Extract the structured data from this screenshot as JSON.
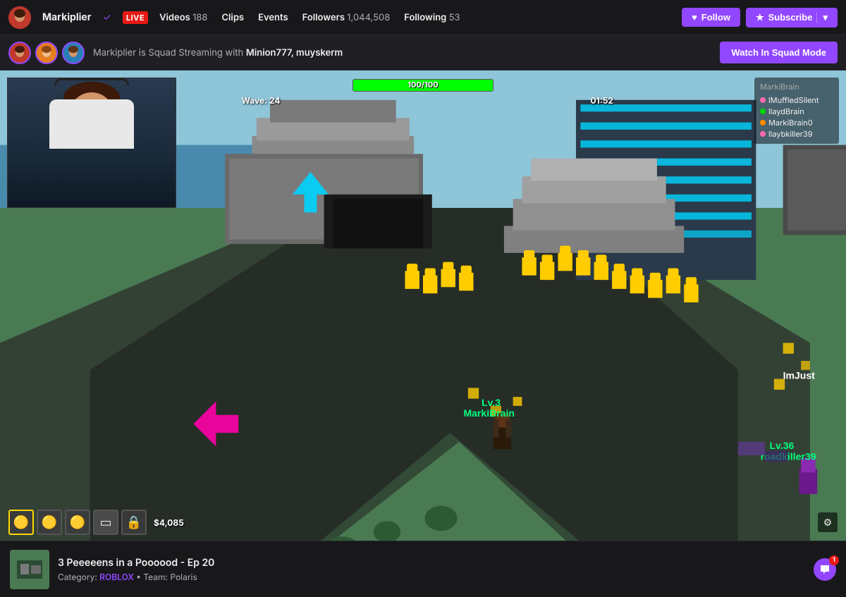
{
  "nav": {
    "channel_name": "Markiplier",
    "live_label": "LIVE",
    "videos_label": "Videos",
    "videos_count": "188",
    "clips_label": "Clips",
    "events_label": "Events",
    "followers_label": "Followers",
    "followers_count": "1,044,508",
    "following_label": "Following",
    "following_count": "53",
    "follow_button": "Follow",
    "subscribe_button": "Subscribe"
  },
  "squad": {
    "text_before": "Markiplier is Squad Streaming with",
    "partners": "Minion777, muyskerm",
    "watch_button": "Watch In Squad Mode"
  },
  "hud": {
    "health": "100/100",
    "wave": "Wave: 24",
    "timer": "01:52"
  },
  "player_list": {
    "title": "MarkiBrain",
    "players": [
      {
        "name": "lMuffledSilent",
        "color": "pink"
      },
      {
        "name": "llaydBrain",
        "color": "green"
      },
      {
        "name": "MarkiBrain0",
        "color": "orange"
      },
      {
        "name": "llaybkiller39",
        "color": "pink"
      }
    ]
  },
  "game_labels": {
    "markibrain": "MarkiBrain",
    "roadkiller": "roadkiller39",
    "imjust": "ImJust"
  },
  "inventory": {
    "money": "$4,085"
  },
  "stream_info": {
    "title": "3 Peeeeens in a Poooood - Ep 20",
    "category_label": "Category:",
    "category": "ROBLOX",
    "team_label": "Team:",
    "team": "Polaris"
  },
  "chat": {
    "badge_count": "1"
  }
}
